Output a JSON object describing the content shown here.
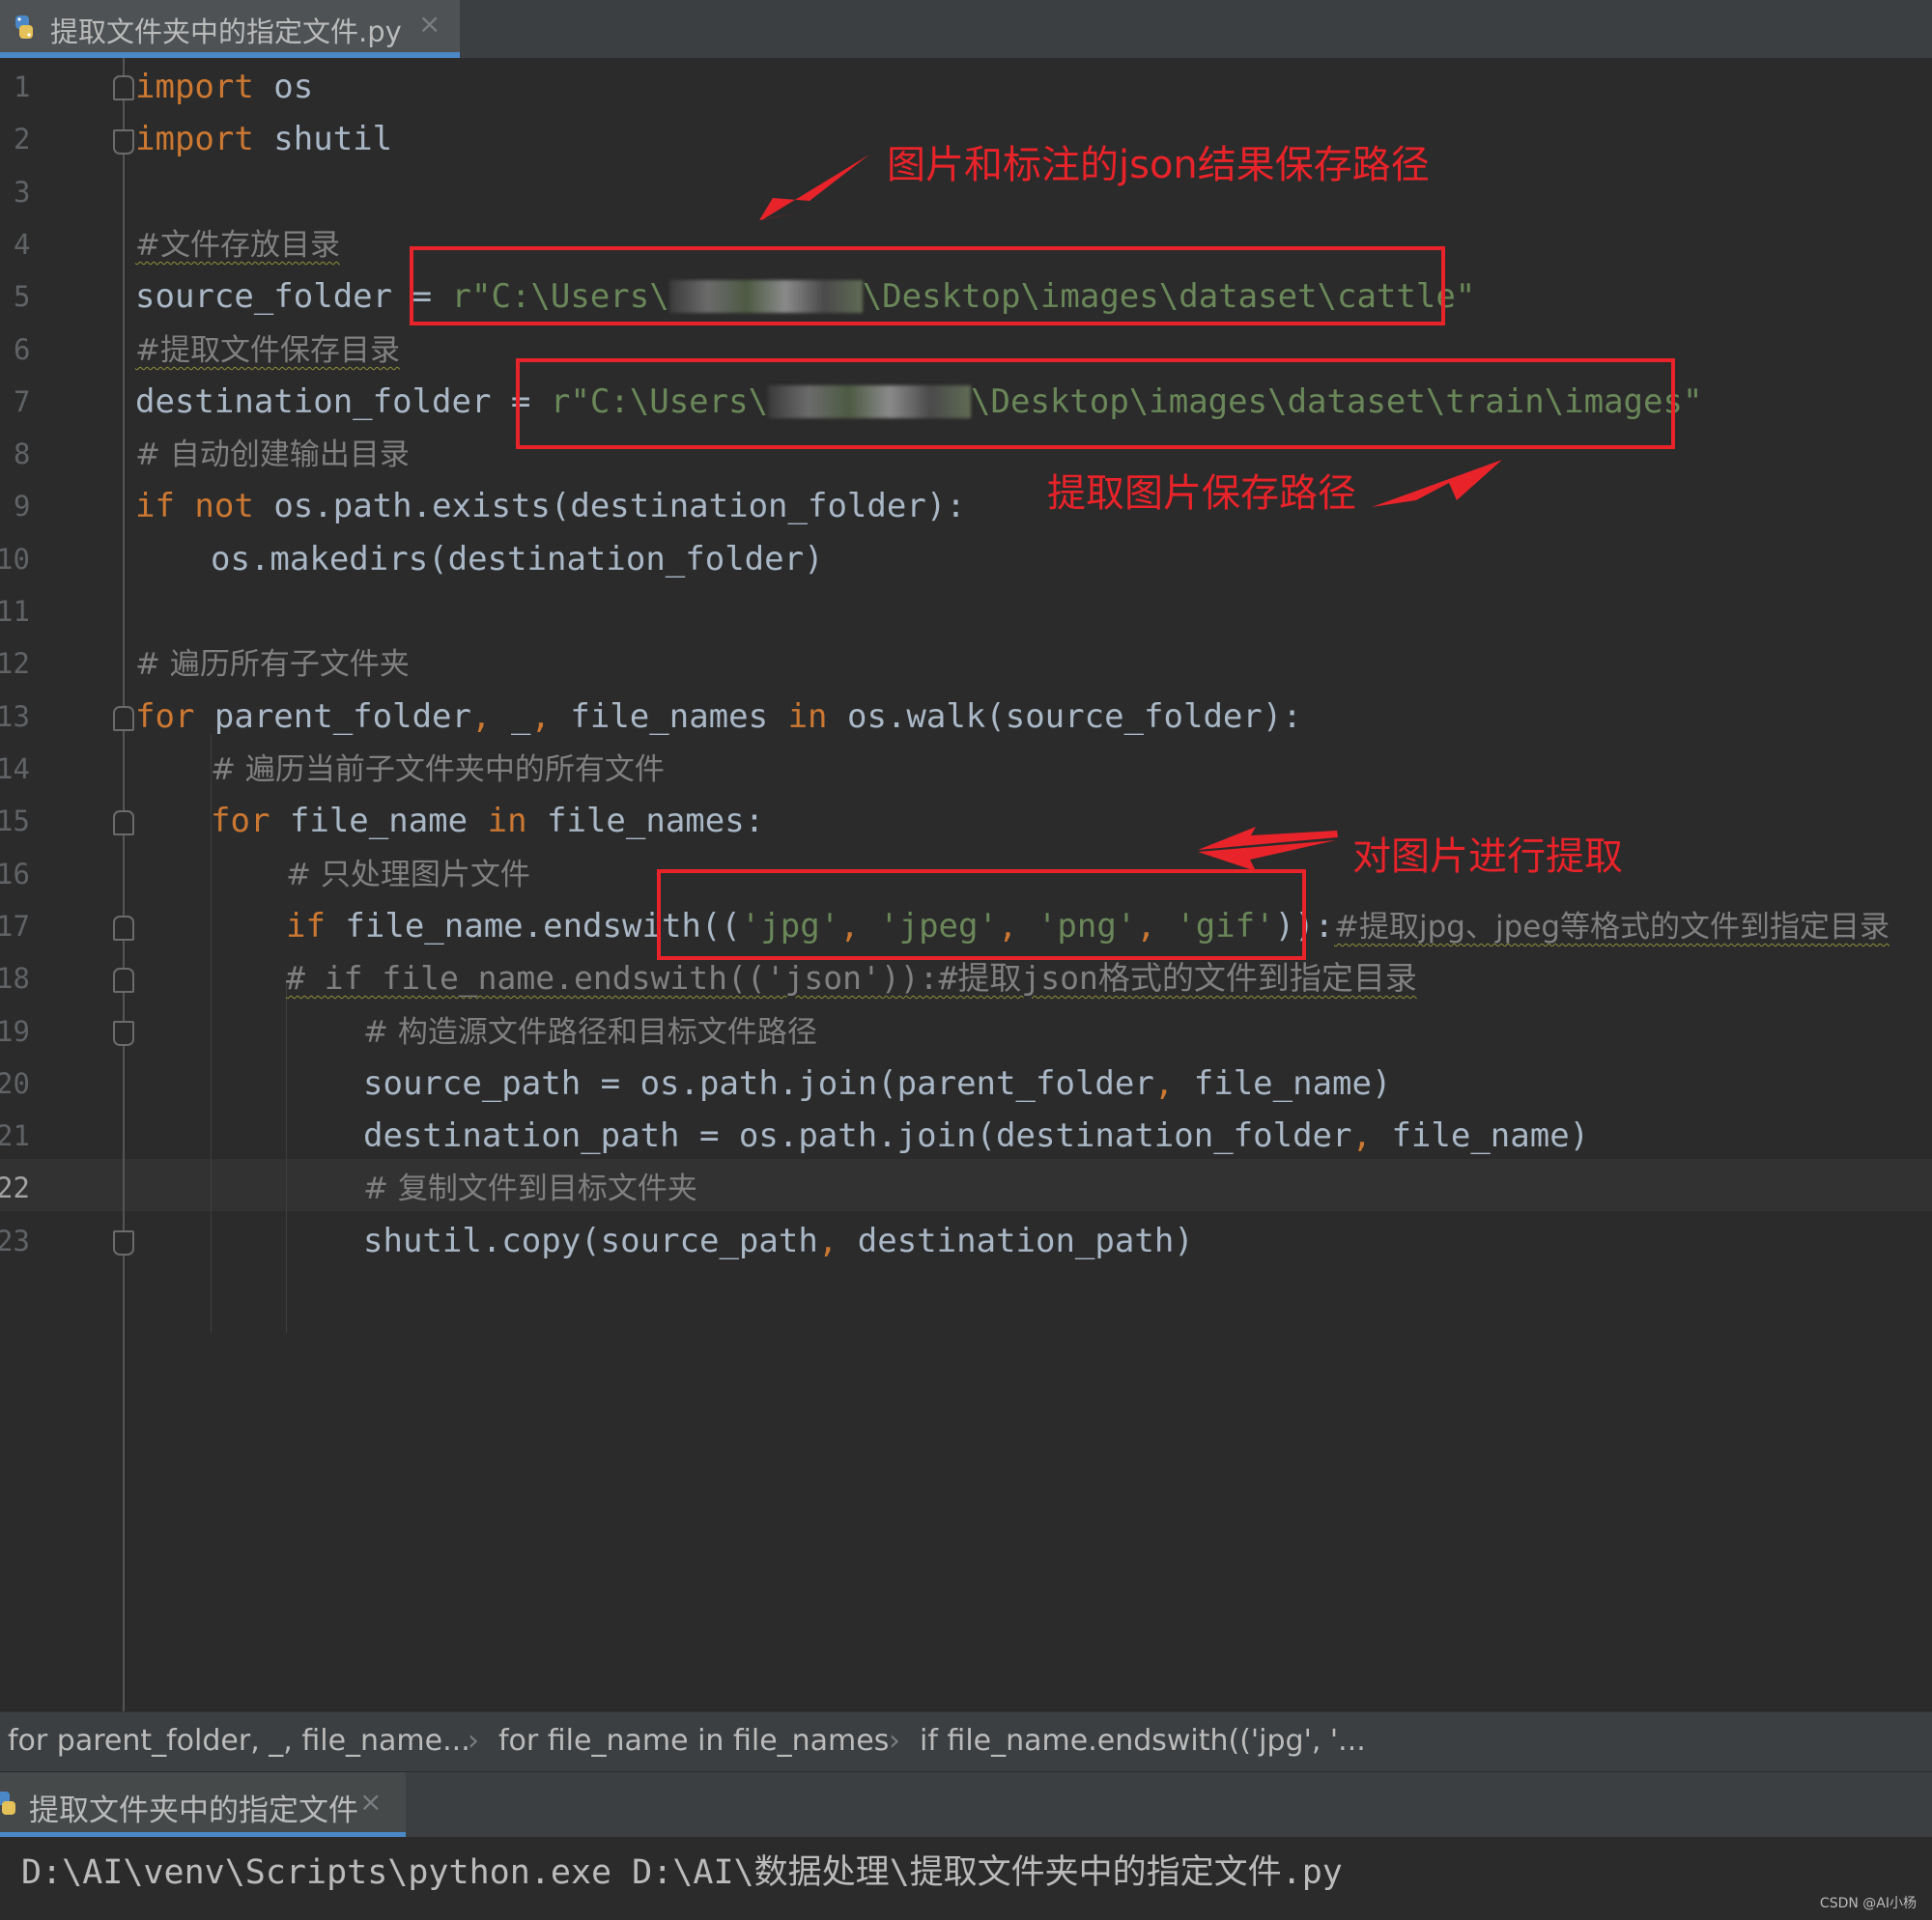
{
  "tab": {
    "title": "提取文件夹中的指定文件.py",
    "close": "×"
  },
  "line_numbers": [
    "1",
    "2",
    "3",
    "4",
    "5",
    "6",
    "7",
    "8",
    "9",
    "10",
    "11",
    "12",
    "13",
    "14",
    "15",
    "16",
    "17",
    "18",
    "19",
    "20",
    "21",
    "22",
    "23"
  ],
  "code": {
    "l1_kw": "import",
    "l1_rest": " os",
    "l2_kw": "import",
    "l2_rest": " shutil",
    "l4": "#文件存放目录",
    "l5_a": "source_folder ",
    "l5_eq": "= ",
    "l5_s1": "r\"C:\\Users\\",
    "l5_s2": "\\Desktop\\images\\dataset\\cattle\"",
    "l6": "#提取文件保存目录",
    "l7_a": "destination_folder = ",
    "l7_s1": "r\"C:\\Users\\",
    "l7_s2": "\\Desktop\\images\\dataset\\train\\images\"",
    "l8": "# 自动创建输出目录",
    "l9_kw1": "if",
    "l9_kw2": " not",
    "l9_rest": " os.path.exists(destination_folder):",
    "l10": "os.makedirs(destination_folder)",
    "l12": "# 遍历所有子文件夹",
    "l13_kw": "for",
    "l13_a": " parent_folder",
    "l13_c1": ",",
    "l13_b": " _",
    "l13_c2": ",",
    "l13_c": " file_names ",
    "l13_in": "in",
    "l13_d": " os.walk(source_folder):",
    "l14": "# 遍历当前子文件夹中的所有文件",
    "l15_kw": "for",
    "l15_a": " file_name ",
    "l15_in": "in",
    "l15_b": " file_names:",
    "l16": "# 只处理图片文件",
    "l17_kw": "if",
    "l17_a": " file_name.endswith((",
    "l17_s1": "'jpg'",
    "l17_c1": ", ",
    "l17_s2": "'jpeg'",
    "l17_c2": ", ",
    "l17_s3": "'png'",
    "l17_c3": ", ",
    "l17_s4": "'gif'",
    "l17_b": ")):",
    "l17_cmt": "#提取jpg、jpeg等格式的文件到指定目录",
    "l18": "# if file_name.endswith(('json')):#提取json格式的文件到指定目录",
    "l19": "# 构造源文件路径和目标文件路径",
    "l20_a": "source_path = os.path.join(parent_folder",
    "l20_c": ",",
    "l20_b": " file_name)",
    "l21_a": "destination_path = os.path.join(destination_folder",
    "l21_c": ",",
    "l21_b": " file_name)",
    "l22": "# 复制文件到目标文件夹",
    "l23_a": "shutil.copy(source_path",
    "l23_c": ",",
    "l23_b": " destination_path)"
  },
  "annotations": {
    "json_path": "图片和标注的json结果保存路径",
    "extract_path": "提取图片保存路径",
    "extract_images": "对图片进行提取"
  },
  "breadcrumb": [
    "for parent_folder, _, file_name...",
    "for file_name in file_names",
    "if file_name.endswith(('jpg', '..."
  ],
  "breadcrumb_sep": "›",
  "run": {
    "tab": "提取文件夹中的指定文件",
    "close": "×",
    "command": "D:\\AI\\venv\\Scripts\\python.exe D:\\AI\\数据处理\\提取文件夹中的指定文件.py"
  },
  "watermark": "CSDN @AI小杨",
  "colors": {
    "background": "#2b2b2b",
    "keyword": "#cc7832",
    "string": "#6a8759",
    "comment": "#808080",
    "annotation_red": "#e8232a"
  }
}
